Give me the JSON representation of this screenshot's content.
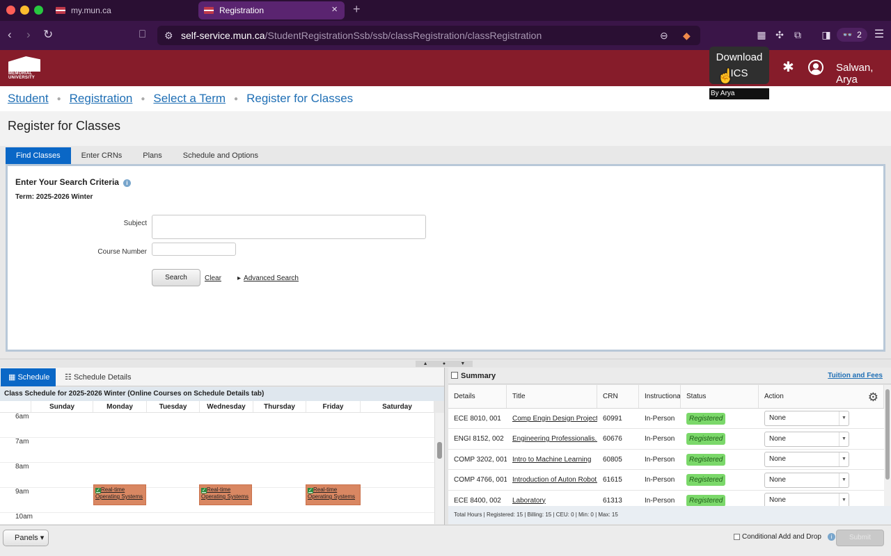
{
  "browser": {
    "tabs": [
      {
        "label": "my.mun.ca"
      },
      {
        "label": "Registration"
      }
    ],
    "url_domain": "self-service.mun.ca",
    "url_path": "/StudentRegistrationSsb/ssb/classRegistration/classRegistration",
    "extension_count": "2"
  },
  "header": {
    "logo_line1": "MEMORIAL",
    "logo_line2": "UNIVERSITY",
    "user_name": "Salwan, Arya"
  },
  "tooltip": {
    "line1": "Download",
    "line2": "ICS",
    "by": "By Arya"
  },
  "breadcrumb": {
    "items": [
      "Student",
      "Registration",
      "Select a Term"
    ],
    "current": "Register for Classes"
  },
  "page_title": "Register for Classes",
  "tabs": [
    "Find Classes",
    "Enter CRNs",
    "Plans",
    "Schedule and Options"
  ],
  "search": {
    "heading": "Enter Your Search Criteria",
    "term": "Term: 2025-2026 Winter",
    "subject_label": "Subject",
    "subject_value": "",
    "course_label": "Course Number",
    "course_value": "",
    "search_btn": "Search",
    "clear": "Clear",
    "advanced": "Advanced Search"
  },
  "schedule": {
    "tab_schedule": "Schedule",
    "tab_details": "Schedule Details",
    "heading": "Class Schedule for 2025-2026 Winter (Online Courses on Schedule Details tab)",
    "days": [
      "Sunday",
      "Monday",
      "Tuesday",
      "Wednesday",
      "Thursday",
      "Friday",
      "Saturday"
    ],
    "hours": [
      "6am",
      "7am",
      "8am",
      "9am",
      "10am"
    ],
    "event_line1": "Real-time",
    "event_line2": "Operating Systems"
  },
  "summary": {
    "title": "Summary",
    "tuition_link": "Tuition and Fees",
    "columns": [
      "Details",
      "Title",
      "CRN",
      "Instructional",
      "Status",
      "Action"
    ],
    "rows": [
      {
        "details": "ECE 8010, 001",
        "title": "Comp Engin Design Project II",
        "crn": "60991",
        "instr": "In-Person",
        "status": "Registered",
        "action": "None"
      },
      {
        "details": "ENGI 8152, 002",
        "title": "Engineering Professionalis...",
        "crn": "60676",
        "instr": "In-Person",
        "status": "Registered",
        "action": "None"
      },
      {
        "details": "COMP 3202, 001",
        "title": "Intro to Machine Learning",
        "crn": "60805",
        "instr": "In-Person",
        "status": "Registered",
        "action": "None"
      },
      {
        "details": "COMP 4766, 001",
        "title": "Introduction of Auton Robot...",
        "crn": "61615",
        "instr": "In-Person",
        "status": "Registered",
        "action": "None"
      },
      {
        "details": "ECE 8400, 002",
        "title": "Laboratory",
        "crn": "61313",
        "instr": "In-Person",
        "status": "Registered",
        "action": "None"
      }
    ],
    "totals": "Total Hours | Registered: 15 | Billing: 15 | CEU: 0 | Min: 0 | Max: 15"
  },
  "bottom": {
    "panels": "Panels",
    "conditional": "Conditional Add and Drop",
    "submit": "Submit"
  }
}
